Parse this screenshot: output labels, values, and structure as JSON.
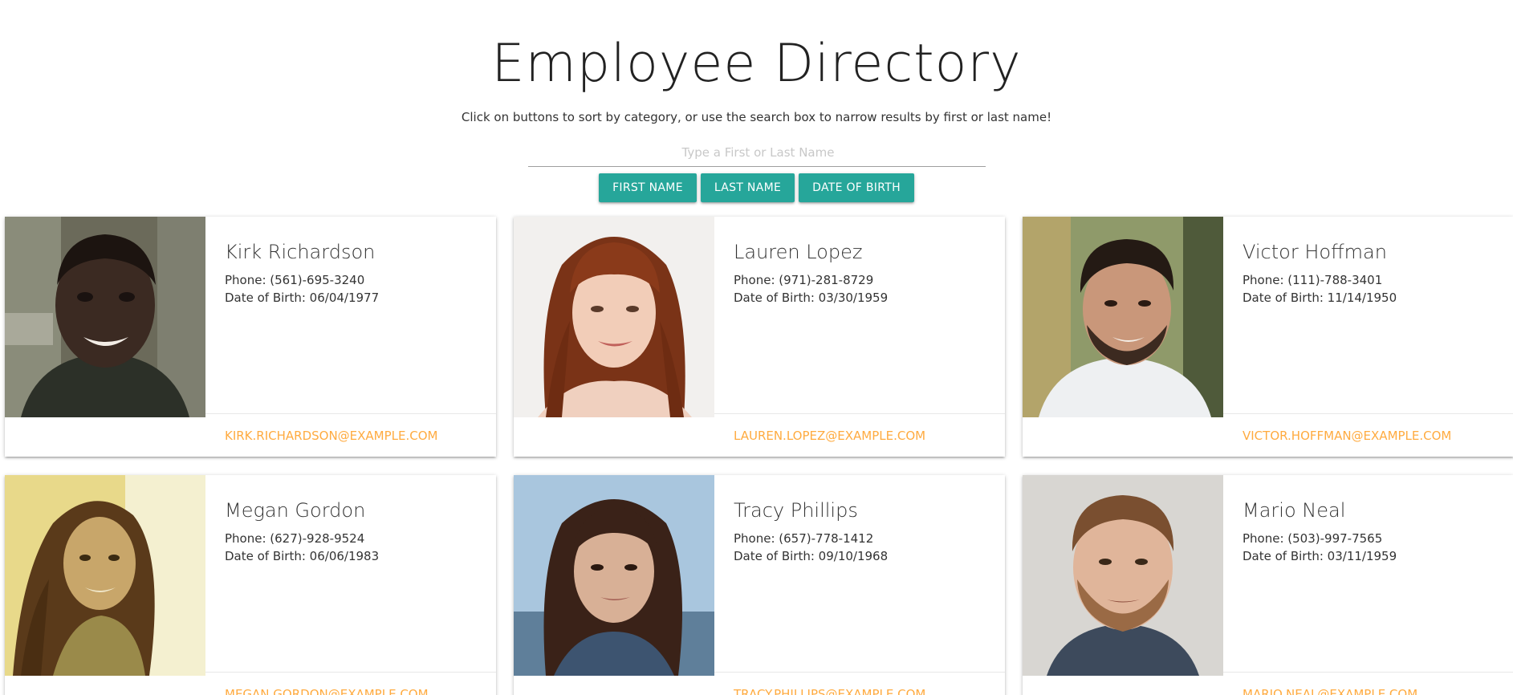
{
  "header": {
    "title": "Employee Directory",
    "subtitle": "Click on buttons to sort by category, or use the search box to narrow results by first or last name!"
  },
  "search": {
    "placeholder": "Type a First or Last Name",
    "value": ""
  },
  "sort_buttons": {
    "first_name": "FIRST NAME",
    "last_name": "LAST NAME",
    "date_of_birth": "DATE OF BIRTH"
  },
  "colors": {
    "button": "#26a69a",
    "email_link": "#ffab40"
  },
  "employees": [
    {
      "name": "Kirk Richardson",
      "phone": "Phone: (561)-695-3240",
      "dob": "Date of Birth: 06/04/1977",
      "email": "KIRK.RICHARDSON@EXAMPLE.COM"
    },
    {
      "name": "Lauren Lopez",
      "phone": "Phone: (971)-281-8729",
      "dob": "Date of Birth: 03/30/1959",
      "email": "LAUREN.LOPEZ@EXAMPLE.COM"
    },
    {
      "name": "Victor Hoffman",
      "phone": "Phone: (111)-788-3401",
      "dob": "Date of Birth: 11/14/1950",
      "email": "VICTOR.HOFFMAN@EXAMPLE.COM"
    },
    {
      "name": "Megan Gordon",
      "phone": "Phone: (627)-928-9524",
      "dob": "Date of Birth: 06/06/1983",
      "email": "MEGAN.GORDON@EXAMPLE.COM"
    },
    {
      "name": "Tracy Phillips",
      "phone": "Phone: (657)-778-1412",
      "dob": "Date of Birth: 09/10/1968",
      "email": "TRACY.PHILLIPS@EXAMPLE.COM"
    },
    {
      "name": "Mario Neal",
      "phone": "Phone: (503)-997-7565",
      "dob": "Date of Birth: 03/11/1959",
      "email": "MARIO.NEAL@EXAMPLE.COM"
    }
  ]
}
